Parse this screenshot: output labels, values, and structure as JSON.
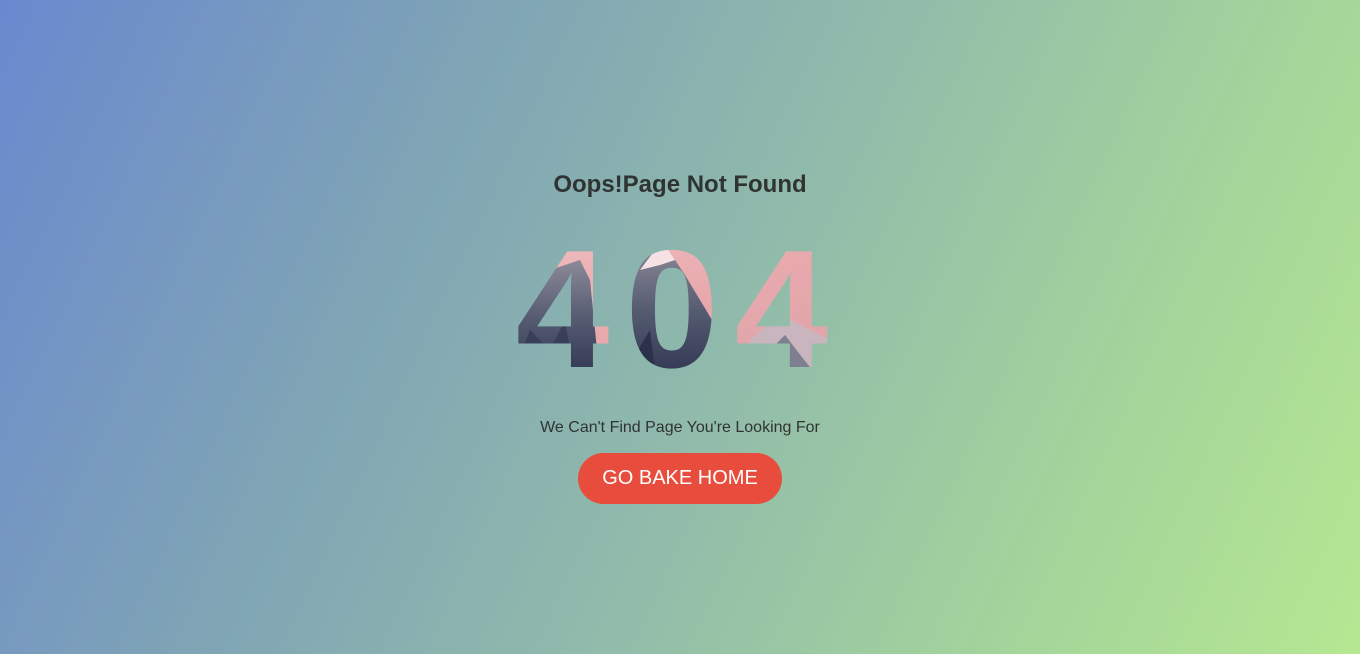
{
  "page": {
    "heading": "Oops!Page Not Found",
    "error_code": "404",
    "message": "We Can't Find Page You're Looking For",
    "home_button_label": "GO BAKE HOME"
  },
  "colors": {
    "gradient_start": "#6a88cf",
    "gradient_end": "#b6e792",
    "button": "#e84c3c",
    "text": "#2f3433"
  },
  "graphics": {
    "digit_fill": "snowy-mountain-photo"
  }
}
